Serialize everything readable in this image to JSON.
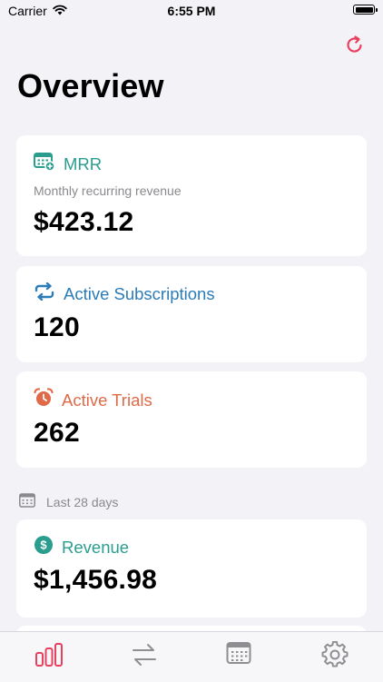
{
  "status_bar": {
    "carrier": "Carrier",
    "time": "6:55 PM"
  },
  "page": {
    "title": "Overview"
  },
  "cards": {
    "mrr": {
      "label": "MRR",
      "subtitle": "Monthly recurring revenue",
      "value": "$423.12"
    },
    "subscriptions": {
      "label": "Active Subscriptions",
      "value": "120"
    },
    "trials": {
      "label": "Active Trials",
      "value": "262"
    },
    "revenue": {
      "label": "Revenue",
      "value": "$1,456.98"
    }
  },
  "section": {
    "label": "Last 28 days"
  },
  "tabs": [
    {
      "icon": "bar-chart-icon",
      "active": true
    },
    {
      "icon": "transfer-arrows-icon",
      "active": false
    },
    {
      "icon": "calendar-icon",
      "active": false
    },
    {
      "icon": "gear-icon",
      "active": false
    }
  ],
  "colors": {
    "background": "#f2f2f7",
    "accent": "#e8405f",
    "mrr": "#2a9d8f",
    "subscriptions": "#2c7cb8",
    "trials": "#e06a48",
    "muted": "#8a8a8e"
  },
  "icons": {
    "refresh": "refresh-icon"
  }
}
